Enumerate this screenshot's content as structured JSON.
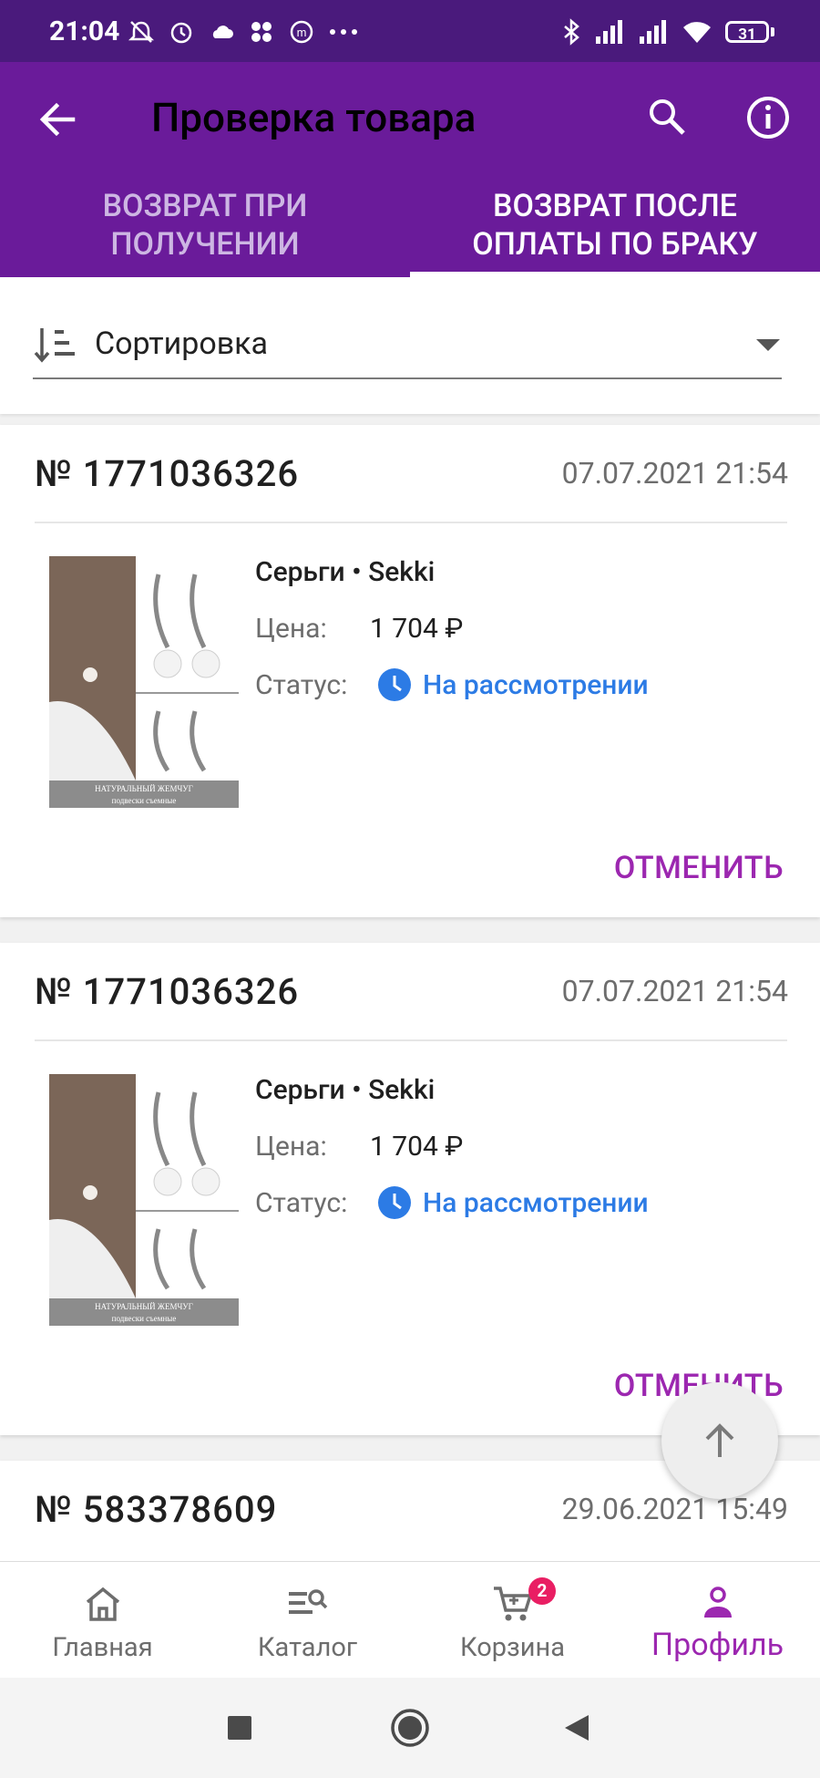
{
  "status_bar": {
    "time": "21:04",
    "battery": "31"
  },
  "appbar": {
    "title": "Проверка товара"
  },
  "tabs": [
    {
      "line1": "ВОЗВРАТ ПРИ",
      "line2": "ПОЛУЧЕНИИ",
      "active": false
    },
    {
      "line1": "ВОЗВРАТ ПОСЛЕ",
      "line2": "ОПЛАТЫ ПО БРАКУ",
      "active": true
    }
  ],
  "sort": {
    "label": "Сортировка"
  },
  "labels": {
    "price": "Цена:",
    "status": "Статус:"
  },
  "orders": [
    {
      "number": "№ 1771036326",
      "date": "07.07.2021 21:54",
      "product": "Серьги • Sekki",
      "price": "1 704 ₽",
      "status": "На рассмотрении",
      "thumb_line1": "НАТУРАЛЬНЫЙ ЖЕМЧУГ",
      "thumb_line2": "подвески съемные",
      "action": "ОТМЕНИТЬ"
    },
    {
      "number": "№ 1771036326",
      "date": "07.07.2021 21:54",
      "product": "Серьги • Sekki",
      "price": "1 704 ₽",
      "status": "На рассмотрении",
      "thumb_line1": "НАТУРАЛЬНЫЙ ЖЕМЧУГ",
      "thumb_line2": "подвески съемные",
      "action": "ОТМЕНИТЬ"
    },
    {
      "number": "№ 583378609",
      "date": "29.06.2021 15:49"
    }
  ],
  "bottom_nav": [
    {
      "label": "Главная",
      "icon": "home-icon"
    },
    {
      "label": "Каталог",
      "icon": "catalog-search-icon"
    },
    {
      "label": "Корзина",
      "icon": "cart-icon",
      "badge": "2"
    },
    {
      "label": "Профиль",
      "icon": "profile-icon",
      "active": true
    }
  ],
  "colors": {
    "primary": "#6a1b9a",
    "status_bar": "#4a1a7c",
    "accent": "#9c27b0",
    "status_blue": "#2c7be5",
    "badge": "#e91e63"
  }
}
